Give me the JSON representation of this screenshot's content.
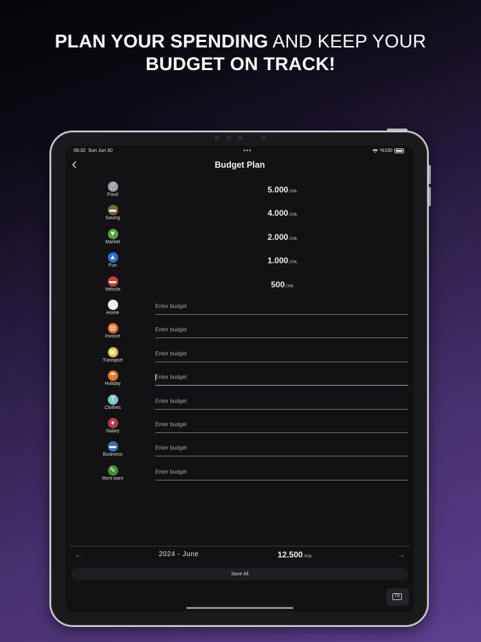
{
  "headline": {
    "line1_bold": "PLAN YOUR SPENDING",
    "line1_light": " AND KEEP YOUR",
    "line2_bold": "BUDGET ON TRACK!"
  },
  "status_bar": {
    "time": "08:32",
    "date": "Sun Jun 30",
    "dots": "•••",
    "battery": "%100"
  },
  "screen_title": "Budget Plan",
  "budget_placeholder": "Enter budget",
  "categories": [
    {
      "label": "Food",
      "icon": "food-icon",
      "amount_int": "5.000",
      "amount_dec": ",00₺",
      "color": "#9aa0a8",
      "glyph": "🍴"
    },
    {
      "label": "Saving",
      "icon": "piggy-bank-icon",
      "amount_int": "4.000",
      "amount_dec": ",00₺",
      "color": "#7a6a3a",
      "glyph": "▬"
    },
    {
      "label": "Market",
      "icon": "basket-icon",
      "amount_int": "2.000",
      "amount_dec": ",00₺",
      "color": "#5aa035",
      "glyph": "▼"
    },
    {
      "label": "Fun",
      "icon": "party-icon",
      "amount_int": "1.000",
      "amount_dec": ",00₺",
      "color": "#2d6fd0",
      "glyph": "▲"
    },
    {
      "label": "Vehicle",
      "icon": "car-icon",
      "amount_int": "500",
      "amount_dec": ",00₺",
      "color": "#d03a3a",
      "glyph": "▬"
    },
    {
      "label": "Home",
      "icon": "home-icon",
      "color": "#eeeeee",
      "glyph": "⌂"
    },
    {
      "label": "Invoice",
      "icon": "invoice-icon",
      "color": "#e86a1c",
      "glyph": "▤"
    },
    {
      "label": "Transport",
      "icon": "bus-icon",
      "color": "#d8c23a",
      "glyph": "▣"
    },
    {
      "label": "Holiday",
      "icon": "beach-icon",
      "color": "#e8782c",
      "glyph": "☂"
    },
    {
      "label": "Clothes",
      "icon": "shirt-icon",
      "color": "#7fc3c8",
      "glyph": "T"
    },
    {
      "label": "Salary",
      "icon": "salary-icon",
      "color": "#b23c4a",
      "glyph": "♦"
    },
    {
      "label": "Business",
      "icon": "briefcase-icon",
      "color": "#3a72b8",
      "glyph": "▬"
    },
    {
      "label": "Rent earn",
      "icon": "rent-icon",
      "color": "#4a8a3a",
      "glyph": "✎"
    }
  ],
  "footer": {
    "prev": "←",
    "next": "→",
    "period": "2024 - June",
    "total_int": "12.500",
    "total_dec": ",00₺",
    "save_all": "Save All",
    "language": "TR"
  }
}
